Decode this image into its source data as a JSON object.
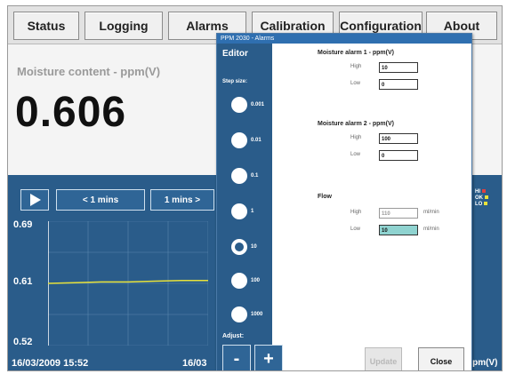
{
  "tabs": [
    "Status",
    "Logging",
    "Alarms",
    "Calibration",
    "Configuration",
    "About"
  ],
  "main": {
    "moisture_label": "Moisture content - ppm(V)",
    "value": "0.606"
  },
  "chart_controls": {
    "prev": "< 1 mins",
    "next": "1 mins >"
  },
  "chart_data": {
    "type": "line",
    "y_ticks": [
      "0.69",
      "0.61",
      "0.52"
    ],
    "ylim": [
      0.52,
      0.69
    ],
    "series": [
      {
        "values": [
          0.605,
          0.606,
          0.607,
          0.607,
          0.608,
          0.609,
          0.609
        ]
      }
    ],
    "start_time": "16/03/2009 15:52",
    "next_time": "16/03",
    "unit": "ppm(V)",
    "legend": [
      "HI",
      "OK",
      "LO"
    ]
  },
  "dialog": {
    "title": "PPM 2030 - Alarms",
    "editor": {
      "title": "Editor",
      "step_label": "Step size:",
      "steps": [
        "0.001",
        "0.01",
        "0.1",
        "1",
        "10",
        "100",
        "1000"
      ],
      "selected_step": "10",
      "adjust_label": "Adjust:",
      "minus": "-",
      "plus": "+"
    },
    "alarm1": {
      "title": "Moisture alarm 1 - ppm(V)",
      "high_label": "High",
      "high": "10",
      "low_label": "Low",
      "low": "0"
    },
    "alarm2": {
      "title": "Moisture alarm 2 - ppm(V)",
      "high_label": "High",
      "high": "100",
      "low_label": "Low",
      "low": "0"
    },
    "flow": {
      "title": "Flow",
      "high_label": "High",
      "high": "110",
      "high_unit": "ml/min",
      "low_label": "Low",
      "low": "10",
      "low_unit": "ml/min"
    },
    "buttons": {
      "update": "Update",
      "close": "Close"
    }
  },
  "colors": {
    "panel_blue": "#2a5c8a",
    "series_yellow": "#e8e23a",
    "highlight_field": "#8fd3d0"
  }
}
